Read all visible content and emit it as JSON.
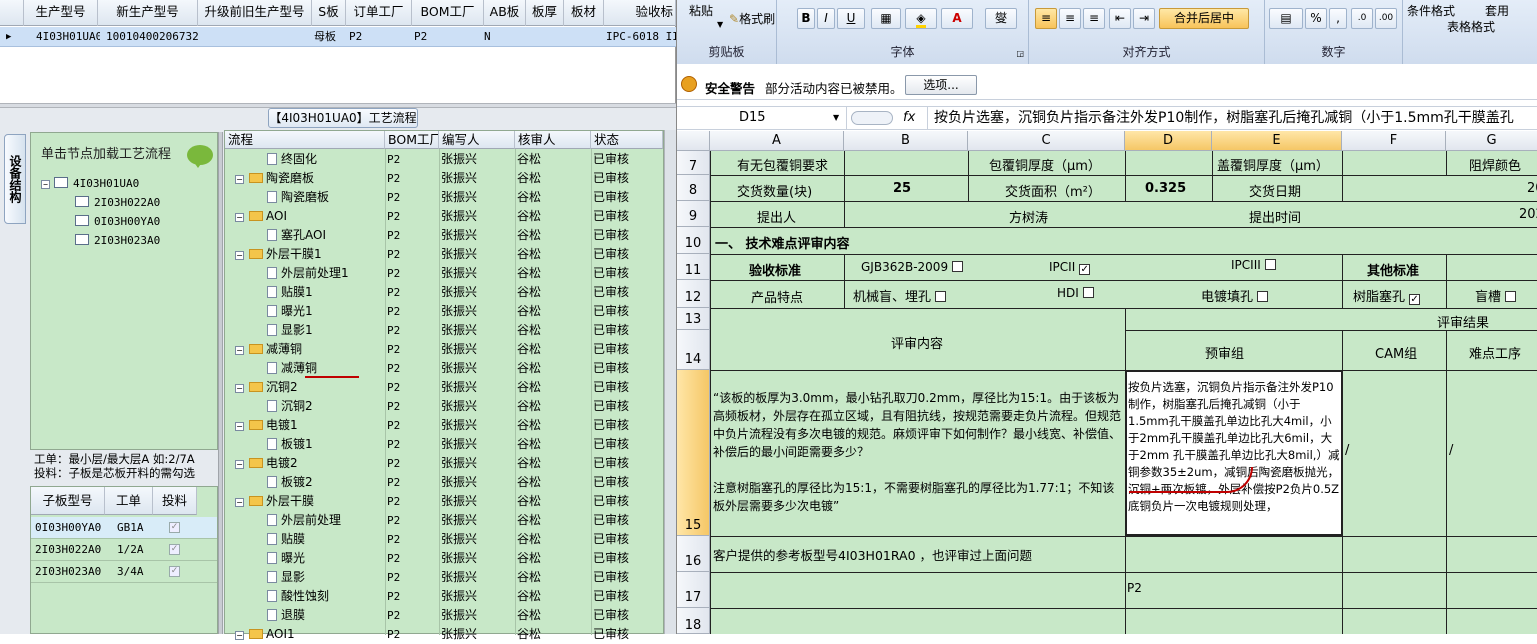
{
  "top_grid": {
    "columns": [
      "生产型号",
      "新生产型号",
      "升级前旧生产型号",
      "S板",
      "订单工厂",
      "BOM工厂",
      "AB板",
      "板厚",
      "板材",
      "验收标"
    ],
    "row": {
      "marker": "▶",
      "prod_model": "4I03H01UA0",
      "new_model": "10010400206732",
      "old_model": "",
      "s_board": "母板",
      "order_factory": "P2",
      "bom_factory": "P2",
      "ab_board": "N",
      "thickness": "",
      "material": "",
      "acceptance": "IPC-6018 II"
    }
  },
  "flow_panel": {
    "title": "【4I03H01UA0】工艺流程"
  },
  "vertical_tab": {
    "label": "设备结构"
  },
  "left_tree": {
    "hint": "单击节点加载工艺流程",
    "nodes": [
      {
        "label": "4I03H01UA0"
      },
      {
        "label": "2I03H022A0"
      },
      {
        "label": "0I03H00YA0"
      },
      {
        "label": "2I03H023A0"
      }
    ]
  },
  "left_info": {
    "line1": "工单：最小层/最大层A 如:2/7A",
    "line2": "投料：子板是芯板开料的需勾选"
  },
  "sub_grid": {
    "headers": [
      "子板型号",
      "工单",
      "投料"
    ],
    "rows": [
      {
        "model": "0I03H00YA0",
        "order": "GB1A",
        "checked": "✓"
      },
      {
        "model": "2I03H022A0",
        "order": "1/2A",
        "checked": "✓"
      },
      {
        "model": "2I03H023A0",
        "order": "3/4A",
        "checked": "✓"
      }
    ]
  },
  "flow_grid": {
    "headers": [
      "流程",
      "BOM工厂",
      "编写人",
      "核审人",
      "状态"
    ],
    "rows": [
      {
        "kind": "doc",
        "name": "终固化",
        "factory": "P2",
        "author": "张振兴",
        "reviewer": "谷松",
        "status": "已审核"
      },
      {
        "kind": "folder",
        "name": "陶瓷磨板",
        "factory": "P2",
        "author": "张振兴",
        "reviewer": "谷松",
        "status": "已审核"
      },
      {
        "kind": "doc",
        "name": "陶瓷磨板",
        "factory": "P2",
        "author": "张振兴",
        "reviewer": "谷松",
        "status": "已审核"
      },
      {
        "kind": "folder",
        "name": "AOI",
        "factory": "P2",
        "author": "张振兴",
        "reviewer": "谷松",
        "status": "已审核"
      },
      {
        "kind": "doc",
        "name": "塞孔AOI",
        "factory": "P2",
        "author": "张振兴",
        "reviewer": "谷松",
        "status": "已审核"
      },
      {
        "kind": "folder",
        "name": "外层干膜1",
        "factory": "P2",
        "author": "张振兴",
        "reviewer": "谷松",
        "status": "已审核"
      },
      {
        "kind": "doc",
        "name": "外层前处理1",
        "factory": "P2",
        "author": "张振兴",
        "reviewer": "谷松",
        "status": "已审核"
      },
      {
        "kind": "doc",
        "name": "贴膜1",
        "factory": "P2",
        "author": "张振兴",
        "reviewer": "谷松",
        "status": "已审核"
      },
      {
        "kind": "doc",
        "name": "曝光1",
        "factory": "P2",
        "author": "张振兴",
        "reviewer": "谷松",
        "status": "已审核"
      },
      {
        "kind": "doc",
        "name": "显影1",
        "factory": "P2",
        "author": "张振兴",
        "reviewer": "谷松",
        "status": "已审核"
      },
      {
        "kind": "folder",
        "name": "减薄铜",
        "factory": "P2",
        "author": "张振兴",
        "reviewer": "谷松",
        "status": "已审核"
      },
      {
        "kind": "doc",
        "name": "减薄铜",
        "factory": "P2",
        "author": "张振兴",
        "reviewer": "谷松",
        "status": "已审核"
      },
      {
        "kind": "folder",
        "name": "沉铜2",
        "factory": "P2",
        "author": "张振兴",
        "reviewer": "谷松",
        "status": "已审核"
      },
      {
        "kind": "doc",
        "name": "沉铜2",
        "factory": "P2",
        "author": "张振兴",
        "reviewer": "谷松",
        "status": "已审核"
      },
      {
        "kind": "folder",
        "name": "电镀1",
        "factory": "P2",
        "author": "张振兴",
        "reviewer": "谷松",
        "status": "已审核"
      },
      {
        "kind": "doc",
        "name": "板镀1",
        "factory": "P2",
        "author": "张振兴",
        "reviewer": "谷松",
        "status": "已审核"
      },
      {
        "kind": "folder",
        "name": "电镀2",
        "factory": "P2",
        "author": "张振兴",
        "reviewer": "谷松",
        "status": "已审核"
      },
      {
        "kind": "doc",
        "name": "板镀2",
        "factory": "P2",
        "author": "张振兴",
        "reviewer": "谷松",
        "status": "已审核"
      },
      {
        "kind": "folder",
        "name": "外层干膜",
        "factory": "P2",
        "author": "张振兴",
        "reviewer": "谷松",
        "status": "已审核"
      },
      {
        "kind": "doc",
        "name": "外层前处理",
        "factory": "P2",
        "author": "张振兴",
        "reviewer": "谷松",
        "status": "已审核"
      },
      {
        "kind": "doc",
        "name": "贴膜",
        "factory": "P2",
        "author": "张振兴",
        "reviewer": "谷松",
        "status": "已审核"
      },
      {
        "kind": "doc",
        "name": "曝光",
        "factory": "P2",
        "author": "张振兴",
        "reviewer": "谷松",
        "status": "已审核"
      },
      {
        "kind": "doc",
        "name": "显影",
        "factory": "P2",
        "author": "张振兴",
        "reviewer": "谷松",
        "status": "已审核"
      },
      {
        "kind": "doc",
        "name": "酸性蚀刻",
        "factory": "P2",
        "author": "张振兴",
        "reviewer": "谷松",
        "status": "已审核"
      },
      {
        "kind": "doc",
        "name": "退膜",
        "factory": "P2",
        "author": "张振兴",
        "reviewer": "谷松",
        "status": "已审核"
      },
      {
        "kind": "folder",
        "name": "AOI1",
        "factory": "P2",
        "author": "张振兴",
        "reviewer": "谷松",
        "status": "已审核"
      }
    ]
  },
  "excel": {
    "ribbon": {
      "paste": "粘贴",
      "format_painter": "格式刷",
      "clipboard": "剪贴板",
      "font_group": "字体",
      "align_group": "对齐方式",
      "merge_center": "合并后居中",
      "number_group": "数字",
      "cond_format": "条件格式",
      "table_format": "表格格式",
      "apply": "套用",
      "bold": "B",
      "italic": "I",
      "underline": "U",
      "font_color": "A",
      "wen": "燮",
      "percent": "%",
      "comma": ","
    },
    "security": {
      "title": "安全警告",
      "message": "部分活动内容已被禁用。",
      "options_button": "选项..."
    },
    "formula": {
      "name_box": "D15",
      "fx": "fx",
      "content": "按负片选塞，沉铜负片指示备注外发P10制作，树脂塞孔后掩孔减铜（小于1.5mm孔干膜盖孔"
    },
    "columns": [
      "A",
      "B",
      "C",
      "D",
      "E",
      "F",
      "G"
    ],
    "rows": [
      "7",
      "8",
      "9",
      "10",
      "11",
      "12",
      "13",
      "14",
      "15",
      "16",
      "17",
      "18"
    ],
    "cells": {
      "r7_a": "有无包覆铜要求",
      "r7_c": "包覆铜厚度（μm）",
      "r7_e": "盖覆铜厚度（μm）",
      "r7_g": "阻焊颜色",
      "r8_a": "交货数量(块)",
      "r8_b": "25",
      "r8_c": "交货面积（m²）",
      "r8_d": "0.325",
      "r8_e": "交货日期",
      "r8_g": "20",
      "r9_a": "提出人",
      "r9_c": "方树涛",
      "r9_e": "提出时间",
      "r9_g": "202",
      "r10_a": "一、 技术难点评审内容",
      "r11_a": "验收标准",
      "r11_b": "GJB362B-2009",
      "r11_d": "IPCII",
      "r11_e": "IPCIII",
      "r11_f": "其他标准",
      "r12_a": "产品特点",
      "r12_b": "机械盲、埋孔",
      "r12_d": "HDI",
      "r12_e": "电镀填孔",
      "r12_f": "树脂塞孔",
      "r12_g": "盲槽",
      "r13_result": "评审结果",
      "r14_content": "评审内容",
      "r14_pre": "预审组",
      "r14_cam": "CAM组",
      "r14_diff": "难点工序",
      "r15_a_p1": "“该板的板厚为3.0mm，最小钻孔取刀0.2mm，厚径比为15:1。由于该板为高频板材，外层存在孤立区域，且有阻抗线，按规范需要走负片流程。但规范中负片流程没有多次电镀的规范。麻烦评审下如何制作？最小线宽、补偿值、补偿后的最小间距需要多少？",
      "r15_a_p2": "注意树脂塞孔的厚径比为15:1，不需要树脂塞孔的厚径比为1.77:1；不知该板外层需要多少次电镀”",
      "r15_d": "按负片选塞，沉铜负片指示备注外发P10制作，树脂塞孔后掩孔减铜（小于1.5mm孔干膜盖孔单边比孔大4mil，小于2mm孔干膜盖孔单边比孔大6mil，大于2mm 孔干膜盖孔单边比孔大8mil,）减铜参数35±2um，减铜后陶瓷磨板抛光，沉铜+两次板镀，外层补偿按P2负片0.5Z底铜负片一次电镀规则处理，",
      "r15_f": "/",
      "r15_g": "/",
      "r16_a": "客户提供的参考板型号4I03H01RA0 ，也评审过上面问题",
      "r17_d": "P2"
    },
    "checks": {
      "c11b": "",
      "c11d": "✓",
      "c11e": "",
      "c12b": "",
      "c12d": "",
      "c12e": "",
      "c12f": "✓",
      "c12g": ""
    }
  },
  "colors": {
    "sheet_bg": "#c8e8c8",
    "selected_row": "#cde0f6",
    "accent": "#f5c766",
    "annotation": "#c00000"
  }
}
